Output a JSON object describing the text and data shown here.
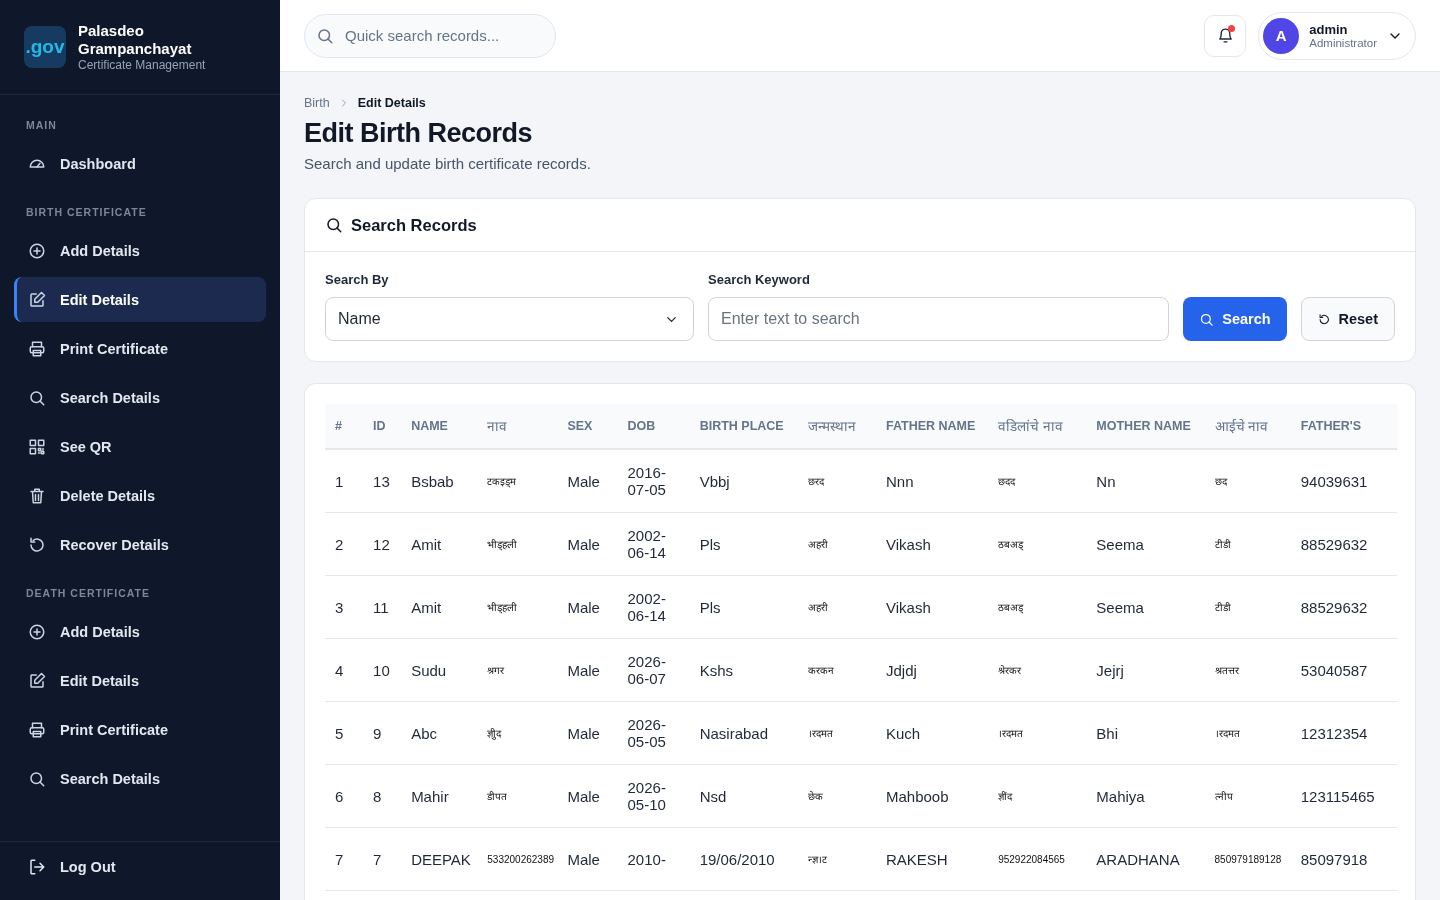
{
  "sidebar": {
    "logo": ".gov",
    "title": "Palasdeo Grampanchayat",
    "subtitle": "Certificate Management",
    "sections": [
      {
        "heading": "MAIN",
        "items": [
          {
            "label": "Dashboard",
            "selected": false
          }
        ]
      },
      {
        "heading": "BIRTH CERTIFICATE",
        "items": [
          {
            "label": "Add Details",
            "selected": false
          },
          {
            "label": "Edit Details",
            "selected": true
          },
          {
            "label": "Print Certificate",
            "selected": false
          },
          {
            "label": "Search Details",
            "selected": false
          },
          {
            "label": "See QR",
            "selected": false
          },
          {
            "label": "Delete Details",
            "selected": false
          },
          {
            "label": "Recover Details",
            "selected": false
          }
        ]
      },
      {
        "heading": "DEATH CERTIFICATE",
        "items": [
          {
            "label": "Add Details",
            "selected": false
          },
          {
            "label": "Edit Details",
            "selected": false
          },
          {
            "label": "Print Certificate",
            "selected": false
          },
          {
            "label": "Search Details",
            "selected": false
          }
        ]
      }
    ],
    "logout": "Log Out"
  },
  "topbar": {
    "search": {
      "placeholder": "Quick search records..."
    },
    "notification": {
      "unread": true
    },
    "user": {
      "initial": "A",
      "name": "admin",
      "role": "Administrator"
    }
  },
  "breadcrumb": [
    "Birth",
    "Edit Details"
  ],
  "page": {
    "title": "Edit Birth Records",
    "subtitle": "Search and update birth certificate records."
  },
  "search_panel": {
    "title": "Search Records",
    "search_by": {
      "label": "Search By",
      "value": "Name"
    },
    "keyword": {
      "label": "Search Keyword",
      "placeholder": "Enter text to search"
    },
    "buttons": [
      {
        "label": "Search",
        "kind": "primary"
      },
      {
        "label": "Reset",
        "kind": "secondary"
      }
    ]
  },
  "table": {
    "columns": [
      {
        "label": "#",
        "kind": "latin"
      },
      {
        "label": "ID",
        "kind": "latin"
      },
      {
        "label": "NAME",
        "kind": "latin"
      },
      {
        "label": "नाव",
        "kind": "local"
      },
      {
        "label": "SEX",
        "kind": "latin"
      },
      {
        "label": "DOB",
        "kind": "latin"
      },
      {
        "label": "BIRTH PLACE",
        "kind": "latin"
      },
      {
        "label": "जन्मस्थान",
        "kind": "local"
      },
      {
        "label": "FATHER NAME",
        "kind": "latin"
      },
      {
        "label": "वडिलांचे नाव",
        "kind": "local"
      },
      {
        "label": "MOTHER NAME",
        "kind": "latin"
      },
      {
        "label": "आईचे नाव",
        "kind": "local"
      },
      {
        "label": "FATHER'S",
        "kind": "latin"
      }
    ],
    "rows": [
      [
        "1",
        "13",
        "Bsbab",
        "टकइड्म",
        "Male",
        "2016-07-05",
        "Vbbj",
        "छरद",
        "Nnn",
        "छदद",
        "Nn",
        "छद",
        "94039631"
      ],
      [
        "2",
        "12",
        "Amit",
        "भीड्हली",
        "Male",
        "2002-06-14",
        "Pls",
        "अहरी",
        "Vikash",
        "ठबअड्",
        "Seema",
        "टीडी",
        "88529632"
      ],
      [
        "3",
        "11",
        "Amit",
        "भीड्हली",
        "Male",
        "2002-06-14",
        "Pls",
        "अहरी",
        "Vikash",
        "ठबअड्",
        "Seema",
        "टीडी",
        "88529632"
      ],
      [
        "4",
        "10",
        "Sudu",
        "श्रगर",
        "Male",
        "2026-06-07",
        "Kshs",
        "करकन",
        "Jdjdj",
        "श्रेरकर",
        "Jejrj",
        "श्रतत्तर",
        "53040587"
      ],
      [
        "5",
        "9",
        "Abc",
        "ज्ञीुद",
        "Male",
        "2026-05-05",
        "Nasirabad",
        "।रदमत",
        "Kuch",
        "।रदमत",
        "Bhi",
        "।रदमत",
        "12312354"
      ],
      [
        "6",
        "8",
        "Mahir",
        "डीपत",
        "Male",
        "2026-05-10",
        "Nsd",
        "छेक",
        "Mahboob",
        "ज्ञींद",
        "Mahiya",
        "त्नीप",
        "123115465"
      ],
      [
        "7",
        "7",
        "DEEPAK",
        "533200262389",
        "Male",
        "2010-",
        "19/06/2010",
        "न्ज्ञ।ट",
        "RAKESH",
        "952922084565",
        "ARADHANA",
        "850979189128",
        "85097918"
      ]
    ]
  }
}
